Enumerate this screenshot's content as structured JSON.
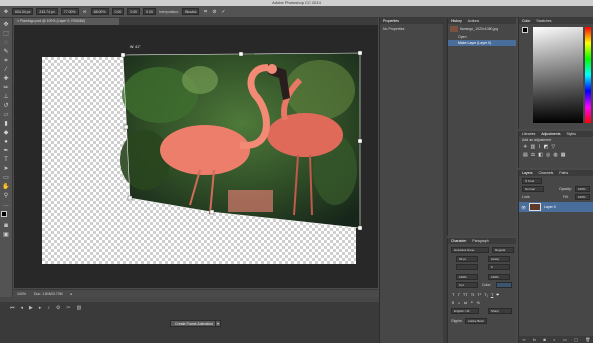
{
  "window": {
    "title": "Adobe Photoshop CC 2014"
  },
  "options_bar": {
    "fields": [
      "604.34 px",
      "243.74 px",
      "77.00%",
      "88.00%",
      "0.00",
      "0.00",
      "0.00"
    ],
    "interpolation_label": "Interpolation:",
    "interpolation_value": "Bicubic",
    "confirm_icon": "✓",
    "cancel_icon": "⊘"
  },
  "document": {
    "tab_title": "Flamingo.psd @ 100% (Layer 0, RGB/8#)",
    "transform_readout": "W: 41°",
    "zoom": "100%",
    "doc_info": "Doc: 1.81M/3.72M"
  },
  "timeline": {
    "button_label": "Create Frame Animation"
  },
  "properties": {
    "tab": "Properties",
    "message": "No Properties"
  },
  "history": {
    "tabs": [
      "History",
      "Actions"
    ],
    "items": [
      "flamingo_1920x1080.jpg",
      "Open",
      "Make Layer (Layer 0)"
    ]
  },
  "color": {
    "tabs": [
      "Color",
      "Swatches"
    ]
  },
  "adjustments": {
    "tabs": [
      "Libraries",
      "Adjustments",
      "Styles"
    ],
    "heading": "Add an adjustment"
  },
  "layers": {
    "tabs": [
      "Layers",
      "Channels",
      "Paths"
    ],
    "blend_mode": "Normal",
    "opacity_label": "Opacity:",
    "opacity": "100%",
    "fill_label": "Fill:",
    "fill": "100%",
    "lock_label": "Lock:",
    "layer_name": "Layer 0"
  },
  "character": {
    "tabs": [
      "Character",
      "Paragraph"
    ],
    "font_family": "Helvetica Neue",
    "font_style": "Regular",
    "size": "36 pt",
    "leading": "(Auto)",
    "tracking": "0",
    "scale_v": "100%",
    "scale_h": "100%",
    "baseline": "0 pt",
    "color_label": "Color:",
    "language": "English: UK",
    "aa": "Sharp",
    "glyphs_label": "Glyphs",
    "glyph_sample": "Adobe Bold"
  },
  "accent": "#4a6e9c"
}
